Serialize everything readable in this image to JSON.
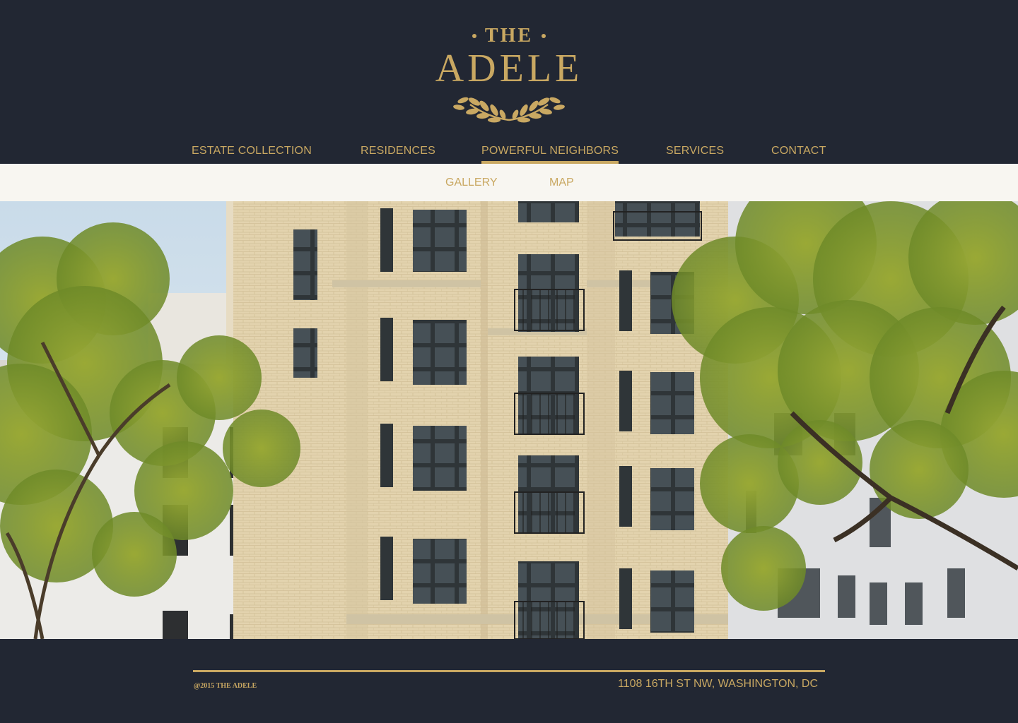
{
  "brand": {
    "prefix": "THE",
    "name": "ADELE",
    "color": "#c9a862"
  },
  "nav": {
    "items": [
      {
        "label": "ESTATE COLLECTION"
      },
      {
        "label": "RESIDENCES"
      },
      {
        "label": "POWERFUL NEIGHBORS",
        "active": true
      },
      {
        "label": "SERVICES"
      },
      {
        "label": "CONTACT"
      }
    ]
  },
  "subnav": {
    "items": [
      {
        "label": "GALLERY"
      },
      {
        "label": "MAP"
      }
    ]
  },
  "footer": {
    "copyright": "@2015 THE ADELE",
    "address": "1108 16TH ST NW, WASHINGTON, DC"
  },
  "colors": {
    "background": "#222733",
    "accent": "#c9a862",
    "subnav_bg": "#f8f6f1"
  }
}
